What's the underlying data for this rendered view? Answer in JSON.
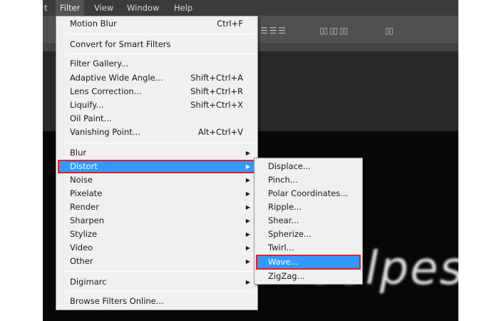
{
  "menubar": {
    "items": [
      {
        "label": "t"
      },
      {
        "label": "Filter"
      },
      {
        "label": "View"
      },
      {
        "label": "Window"
      },
      {
        "label": "Help"
      }
    ]
  },
  "filter_menu": {
    "items": [
      {
        "label": "Motion Blur",
        "shortcut": "Ctrl+F"
      },
      {
        "label": "Convert for Smart Filters"
      },
      {
        "label": "Filter Gallery..."
      },
      {
        "label": "Adaptive Wide Angle...",
        "shortcut": "Shift+Ctrl+A"
      },
      {
        "label": "Lens Correction...",
        "shortcut": "Shift+Ctrl+R"
      },
      {
        "label": "Liquify...",
        "shortcut": "Shift+Ctrl+X"
      },
      {
        "label": "Oil Paint..."
      },
      {
        "label": "Vanishing Point...",
        "shortcut": "Alt+Ctrl+V"
      },
      {
        "label": "Blur"
      },
      {
        "label": "Distort"
      },
      {
        "label": "Noise"
      },
      {
        "label": "Pixelate"
      },
      {
        "label": "Render"
      },
      {
        "label": "Sharpen"
      },
      {
        "label": "Stylize"
      },
      {
        "label": "Video"
      },
      {
        "label": "Other"
      },
      {
        "label": "Digimarc"
      },
      {
        "label": "Browse Filters Online..."
      }
    ]
  },
  "distort_menu": {
    "items": [
      {
        "label": "Displace..."
      },
      {
        "label": "Pinch..."
      },
      {
        "label": "Polar Coordinates..."
      },
      {
        "label": "Ripple..."
      },
      {
        "label": "Shear..."
      },
      {
        "label": "Spherize..."
      },
      {
        "label": "Twirl..."
      },
      {
        "label": "Wave..."
      },
      {
        "label": "ZigZag..."
      }
    ]
  },
  "canvas_text": "eelpes",
  "colors": {
    "highlight": "#3399ff",
    "callout": "#e0202c"
  }
}
